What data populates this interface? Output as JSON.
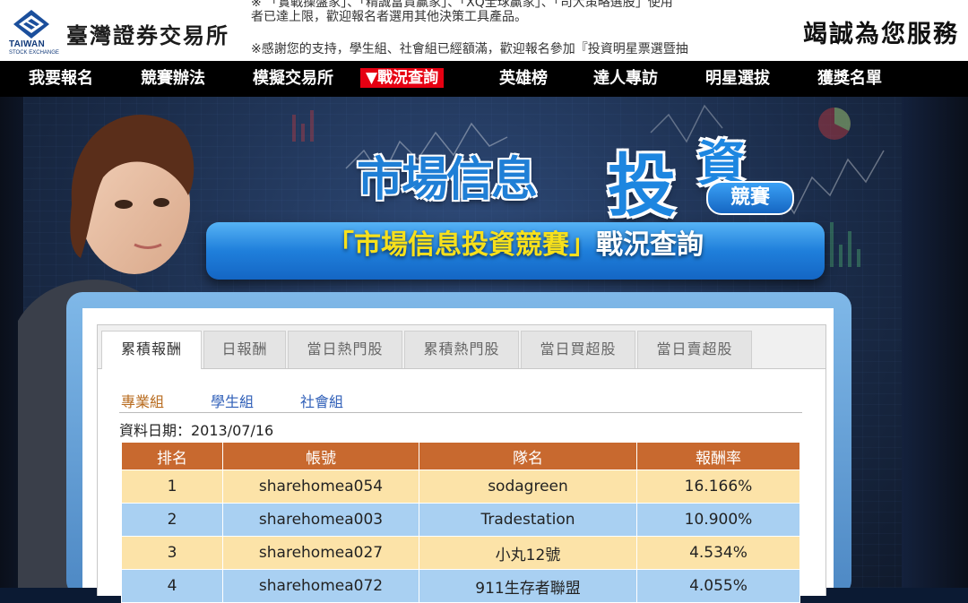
{
  "header": {
    "logo_en": "TAIWAN",
    "logo_en_sub": "STOCK EXCHANGE",
    "logo_zh": "臺灣證券交易所",
    "slogan": "竭誠為您服務",
    "marquee": {
      "line1": "※  「實戰操盤家」、「精誠富貴贏家」、「XQ全球贏家」、「司大策略選股」使用",
      "line2": "者已達上限，歡迎報名者選用其他決策工具產品。",
      "line3": "※感謝您的支持，學生組、社會組已經額滿，歡迎報名參加『投資明星票選暨抽"
    }
  },
  "nav": {
    "items": [
      "我要報名",
      "競賽辦法",
      "模擬交易所",
      "▼戰況查詢",
      "英雄榜",
      "達人專訪",
      "明星選拔",
      "獲獎名單"
    ],
    "active_index": 3
  },
  "hero": {
    "title_small": "市場信息",
    "title_big1": "投",
    "title_big2": "資",
    "title_pill": "競賽",
    "banner_quote_open": "「",
    "banner_main": "市場信息投資競賽",
    "banner_quote_close": "」",
    "banner_suffix": "戰況查詢"
  },
  "tabs": [
    "累積報酬",
    "日報酬",
    "當日熱門股",
    "累積熱門股",
    "當日買超股",
    "當日賣超股"
  ],
  "active_tab": 0,
  "groups": [
    "專業組",
    "學生組",
    "社會組"
  ],
  "active_group": 0,
  "date_label": "資料日期：2013/07/16",
  "table": {
    "headers": [
      "排名",
      "帳號",
      "隊名",
      "報酬率"
    ],
    "rows": [
      [
        "1",
        "sharehomea054",
        "sodagreen",
        "16.166%"
      ],
      [
        "2",
        "sharehomea003",
        "Tradestation",
        "10.900%"
      ],
      [
        "3",
        "sharehomea027",
        "小丸12號",
        "4.534%"
      ],
      [
        "4",
        "sharehomea072",
        "911生存者聯盟",
        "4.055%"
      ]
    ]
  },
  "colors": {
    "nav_active": "#e60012",
    "table_header": "#c8692f",
    "row_even": "#fce3a8",
    "row_odd": "#a9d0f2",
    "banner": "#1f7fdb",
    "active_group": "#b86b1e",
    "group_link": "#2f5fb8"
  }
}
